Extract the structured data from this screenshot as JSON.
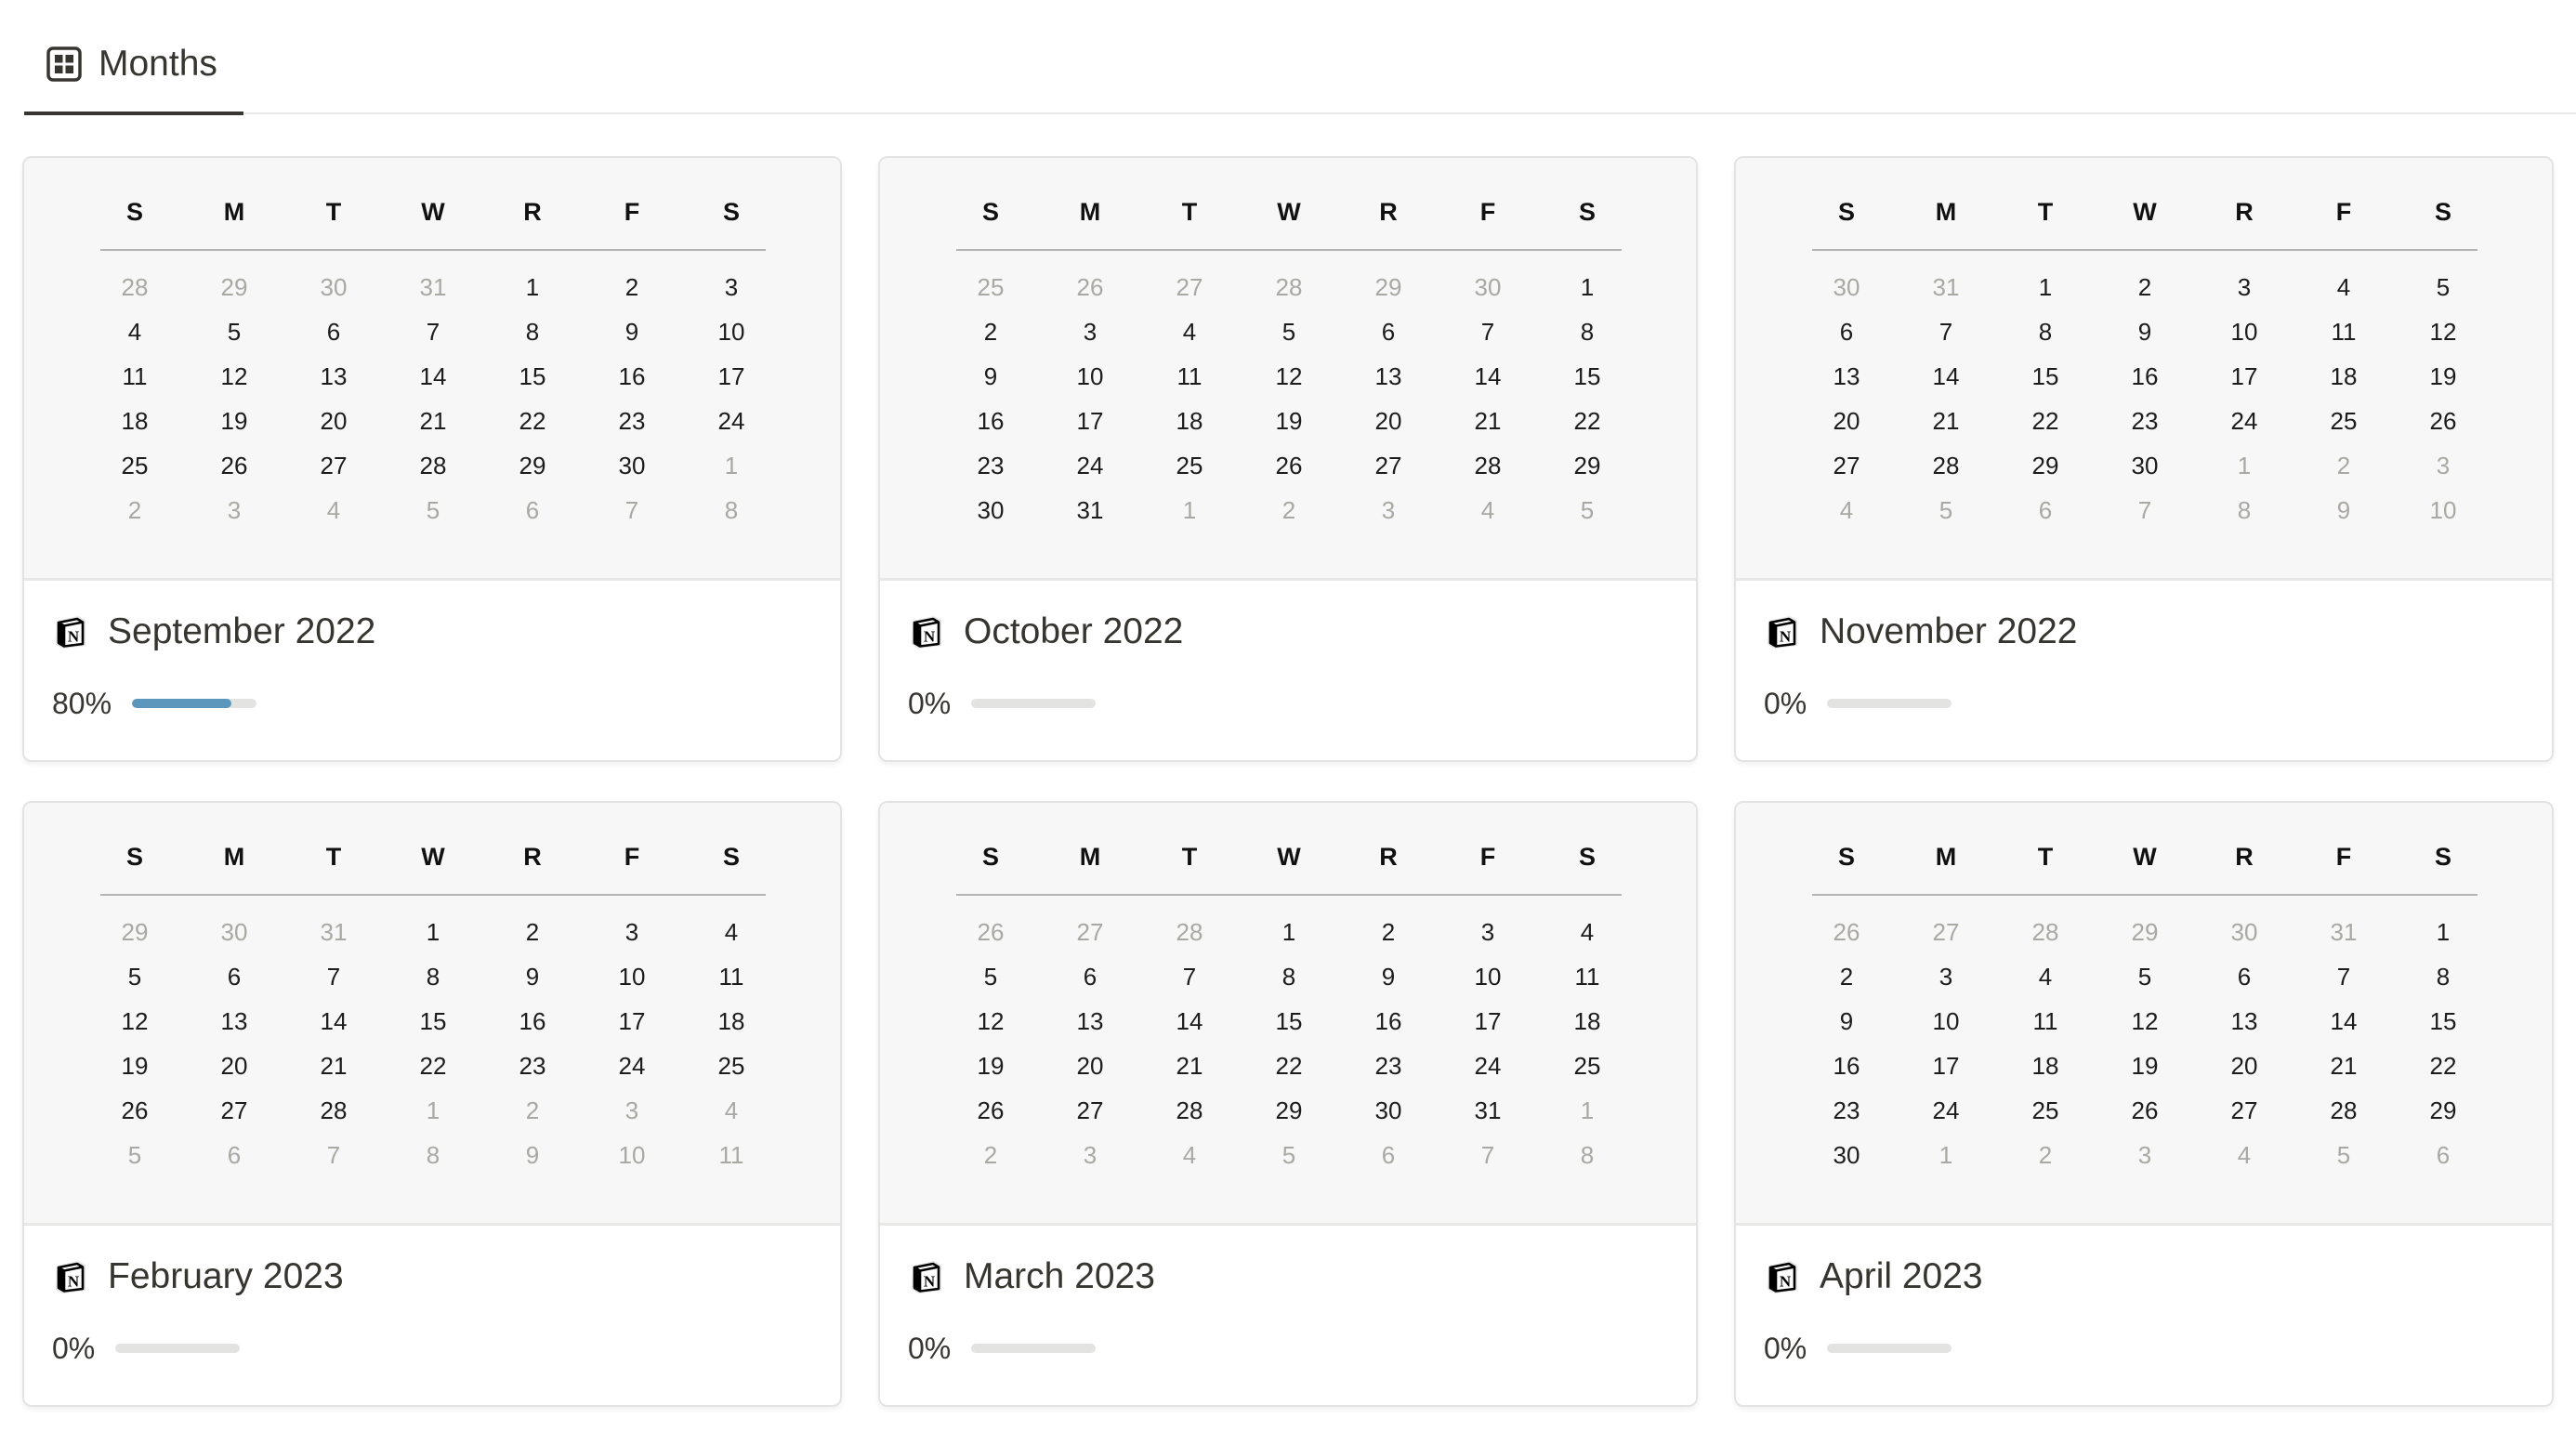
{
  "view_tab": {
    "label": "Months",
    "icon": "gallery-view-icon"
  },
  "weekday_headers": [
    "S",
    "M",
    "T",
    "W",
    "R",
    "F",
    "S"
  ],
  "colors": {
    "progress_fill": "#5b97bd",
    "progress_track": "#e3e3e1",
    "muted_day": "#a9a8a3"
  },
  "cards": [
    {
      "title": "September 2022",
      "icon": "notion-logo-icon",
      "progress_label": "80%",
      "progress": 0.8,
      "weeks": [
        [
          {
            "d": "28",
            "m": true
          },
          {
            "d": "29",
            "m": true
          },
          {
            "d": "30",
            "m": true
          },
          {
            "d": "31",
            "m": true
          },
          {
            "d": "1"
          },
          {
            "d": "2"
          },
          {
            "d": "3"
          }
        ],
        [
          {
            "d": "4"
          },
          {
            "d": "5"
          },
          {
            "d": "6"
          },
          {
            "d": "7"
          },
          {
            "d": "8"
          },
          {
            "d": "9"
          },
          {
            "d": "10"
          }
        ],
        [
          {
            "d": "11"
          },
          {
            "d": "12"
          },
          {
            "d": "13"
          },
          {
            "d": "14"
          },
          {
            "d": "15"
          },
          {
            "d": "16"
          },
          {
            "d": "17"
          }
        ],
        [
          {
            "d": "18"
          },
          {
            "d": "19"
          },
          {
            "d": "20"
          },
          {
            "d": "21"
          },
          {
            "d": "22"
          },
          {
            "d": "23"
          },
          {
            "d": "24"
          }
        ],
        [
          {
            "d": "25"
          },
          {
            "d": "26"
          },
          {
            "d": "27"
          },
          {
            "d": "28"
          },
          {
            "d": "29"
          },
          {
            "d": "30"
          },
          {
            "d": "1",
            "m": true
          }
        ],
        [
          {
            "d": "2",
            "m": true
          },
          {
            "d": "3",
            "m": true
          },
          {
            "d": "4",
            "m": true
          },
          {
            "d": "5",
            "m": true
          },
          {
            "d": "6",
            "m": true
          },
          {
            "d": "7",
            "m": true
          },
          {
            "d": "8",
            "m": true
          }
        ]
      ]
    },
    {
      "title": "October 2022",
      "icon": "notion-logo-icon",
      "progress_label": "0%",
      "progress": 0,
      "weeks": [
        [
          {
            "d": "25",
            "m": true
          },
          {
            "d": "26",
            "m": true
          },
          {
            "d": "27",
            "m": true
          },
          {
            "d": "28",
            "m": true
          },
          {
            "d": "29",
            "m": true
          },
          {
            "d": "30",
            "m": true
          },
          {
            "d": "1"
          }
        ],
        [
          {
            "d": "2"
          },
          {
            "d": "3"
          },
          {
            "d": "4"
          },
          {
            "d": "5"
          },
          {
            "d": "6"
          },
          {
            "d": "7"
          },
          {
            "d": "8"
          }
        ],
        [
          {
            "d": "9"
          },
          {
            "d": "10"
          },
          {
            "d": "11"
          },
          {
            "d": "12"
          },
          {
            "d": "13"
          },
          {
            "d": "14"
          },
          {
            "d": "15"
          }
        ],
        [
          {
            "d": "16"
          },
          {
            "d": "17"
          },
          {
            "d": "18"
          },
          {
            "d": "19"
          },
          {
            "d": "20"
          },
          {
            "d": "21"
          },
          {
            "d": "22"
          }
        ],
        [
          {
            "d": "23"
          },
          {
            "d": "24"
          },
          {
            "d": "25"
          },
          {
            "d": "26"
          },
          {
            "d": "27"
          },
          {
            "d": "28"
          },
          {
            "d": "29"
          }
        ],
        [
          {
            "d": "30"
          },
          {
            "d": "31"
          },
          {
            "d": "1",
            "m": true
          },
          {
            "d": "2",
            "m": true
          },
          {
            "d": "3",
            "m": true
          },
          {
            "d": "4",
            "m": true
          },
          {
            "d": "5",
            "m": true
          }
        ]
      ]
    },
    {
      "title": "November 2022",
      "icon": "notion-logo-icon",
      "progress_label": "0%",
      "progress": 0,
      "weeks": [
        [
          {
            "d": "30",
            "m": true
          },
          {
            "d": "31",
            "m": true
          },
          {
            "d": "1"
          },
          {
            "d": "2"
          },
          {
            "d": "3"
          },
          {
            "d": "4"
          },
          {
            "d": "5"
          }
        ],
        [
          {
            "d": "6"
          },
          {
            "d": "7"
          },
          {
            "d": "8"
          },
          {
            "d": "9"
          },
          {
            "d": "10"
          },
          {
            "d": "11"
          },
          {
            "d": "12"
          }
        ],
        [
          {
            "d": "13"
          },
          {
            "d": "14"
          },
          {
            "d": "15"
          },
          {
            "d": "16"
          },
          {
            "d": "17"
          },
          {
            "d": "18"
          },
          {
            "d": "19"
          }
        ],
        [
          {
            "d": "20"
          },
          {
            "d": "21"
          },
          {
            "d": "22"
          },
          {
            "d": "23"
          },
          {
            "d": "24"
          },
          {
            "d": "25"
          },
          {
            "d": "26"
          }
        ],
        [
          {
            "d": "27"
          },
          {
            "d": "28"
          },
          {
            "d": "29"
          },
          {
            "d": "30"
          },
          {
            "d": "1",
            "m": true
          },
          {
            "d": "2",
            "m": true
          },
          {
            "d": "3",
            "m": true
          }
        ],
        [
          {
            "d": "4",
            "m": true
          },
          {
            "d": "5",
            "m": true
          },
          {
            "d": "6",
            "m": true
          },
          {
            "d": "7",
            "m": true
          },
          {
            "d": "8",
            "m": true
          },
          {
            "d": "9",
            "m": true
          },
          {
            "d": "10",
            "m": true
          }
        ]
      ]
    },
    {
      "title": "February 2023",
      "icon": "notion-logo-icon",
      "progress_label": "0%",
      "progress": 0,
      "weeks": [
        [
          {
            "d": "29",
            "m": true
          },
          {
            "d": "30",
            "m": true
          },
          {
            "d": "31",
            "m": true
          },
          {
            "d": "1"
          },
          {
            "d": "2"
          },
          {
            "d": "3"
          },
          {
            "d": "4"
          }
        ],
        [
          {
            "d": "5"
          },
          {
            "d": "6"
          },
          {
            "d": "7"
          },
          {
            "d": "8"
          },
          {
            "d": "9"
          },
          {
            "d": "10"
          },
          {
            "d": "11"
          }
        ],
        [
          {
            "d": "12"
          },
          {
            "d": "13"
          },
          {
            "d": "14"
          },
          {
            "d": "15"
          },
          {
            "d": "16"
          },
          {
            "d": "17"
          },
          {
            "d": "18"
          }
        ],
        [
          {
            "d": "19"
          },
          {
            "d": "20"
          },
          {
            "d": "21"
          },
          {
            "d": "22"
          },
          {
            "d": "23"
          },
          {
            "d": "24"
          },
          {
            "d": "25"
          }
        ],
        [
          {
            "d": "26"
          },
          {
            "d": "27"
          },
          {
            "d": "28"
          },
          {
            "d": "1",
            "m": true
          },
          {
            "d": "2",
            "m": true
          },
          {
            "d": "3",
            "m": true
          },
          {
            "d": "4",
            "m": true
          }
        ],
        [
          {
            "d": "5",
            "m": true
          },
          {
            "d": "6",
            "m": true
          },
          {
            "d": "7",
            "m": true
          },
          {
            "d": "8",
            "m": true
          },
          {
            "d": "9",
            "m": true
          },
          {
            "d": "10",
            "m": true
          },
          {
            "d": "11",
            "m": true
          }
        ]
      ]
    },
    {
      "title": "March 2023",
      "icon": "notion-logo-icon",
      "progress_label": "0%",
      "progress": 0,
      "weeks": [
        [
          {
            "d": "26",
            "m": true
          },
          {
            "d": "27",
            "m": true
          },
          {
            "d": "28",
            "m": true
          },
          {
            "d": "1"
          },
          {
            "d": "2"
          },
          {
            "d": "3"
          },
          {
            "d": "4"
          }
        ],
        [
          {
            "d": "5"
          },
          {
            "d": "6"
          },
          {
            "d": "7"
          },
          {
            "d": "8"
          },
          {
            "d": "9"
          },
          {
            "d": "10"
          },
          {
            "d": "11"
          }
        ],
        [
          {
            "d": "12"
          },
          {
            "d": "13"
          },
          {
            "d": "14"
          },
          {
            "d": "15"
          },
          {
            "d": "16"
          },
          {
            "d": "17"
          },
          {
            "d": "18"
          }
        ],
        [
          {
            "d": "19"
          },
          {
            "d": "20"
          },
          {
            "d": "21"
          },
          {
            "d": "22"
          },
          {
            "d": "23"
          },
          {
            "d": "24"
          },
          {
            "d": "25"
          }
        ],
        [
          {
            "d": "26"
          },
          {
            "d": "27"
          },
          {
            "d": "28"
          },
          {
            "d": "29"
          },
          {
            "d": "30"
          },
          {
            "d": "31"
          },
          {
            "d": "1",
            "m": true
          }
        ],
        [
          {
            "d": "2",
            "m": true
          },
          {
            "d": "3",
            "m": true
          },
          {
            "d": "4",
            "m": true
          },
          {
            "d": "5",
            "m": true
          },
          {
            "d": "6",
            "m": true
          },
          {
            "d": "7",
            "m": true
          },
          {
            "d": "8",
            "m": true
          }
        ]
      ]
    },
    {
      "title": "April 2023",
      "icon": "notion-logo-icon",
      "progress_label": "0%",
      "progress": 0,
      "weeks": [
        [
          {
            "d": "26",
            "m": true
          },
          {
            "d": "27",
            "m": true
          },
          {
            "d": "28",
            "m": true
          },
          {
            "d": "29",
            "m": true
          },
          {
            "d": "30",
            "m": true
          },
          {
            "d": "31",
            "m": true
          },
          {
            "d": "1"
          }
        ],
        [
          {
            "d": "2"
          },
          {
            "d": "3"
          },
          {
            "d": "4"
          },
          {
            "d": "5"
          },
          {
            "d": "6"
          },
          {
            "d": "7"
          },
          {
            "d": "8"
          }
        ],
        [
          {
            "d": "9"
          },
          {
            "d": "10"
          },
          {
            "d": "11"
          },
          {
            "d": "12"
          },
          {
            "d": "13"
          },
          {
            "d": "14"
          },
          {
            "d": "15"
          }
        ],
        [
          {
            "d": "16"
          },
          {
            "d": "17"
          },
          {
            "d": "18"
          },
          {
            "d": "19"
          },
          {
            "d": "20"
          },
          {
            "d": "21"
          },
          {
            "d": "22"
          }
        ],
        [
          {
            "d": "23"
          },
          {
            "d": "24"
          },
          {
            "d": "25"
          },
          {
            "d": "26"
          },
          {
            "d": "27"
          },
          {
            "d": "28"
          },
          {
            "d": "29"
          }
        ],
        [
          {
            "d": "30"
          },
          {
            "d": "1",
            "m": true
          },
          {
            "d": "2",
            "m": true
          },
          {
            "d": "3",
            "m": true
          },
          {
            "d": "4",
            "m": true
          },
          {
            "d": "5",
            "m": true
          },
          {
            "d": "6",
            "m": true
          }
        ]
      ]
    }
  ]
}
